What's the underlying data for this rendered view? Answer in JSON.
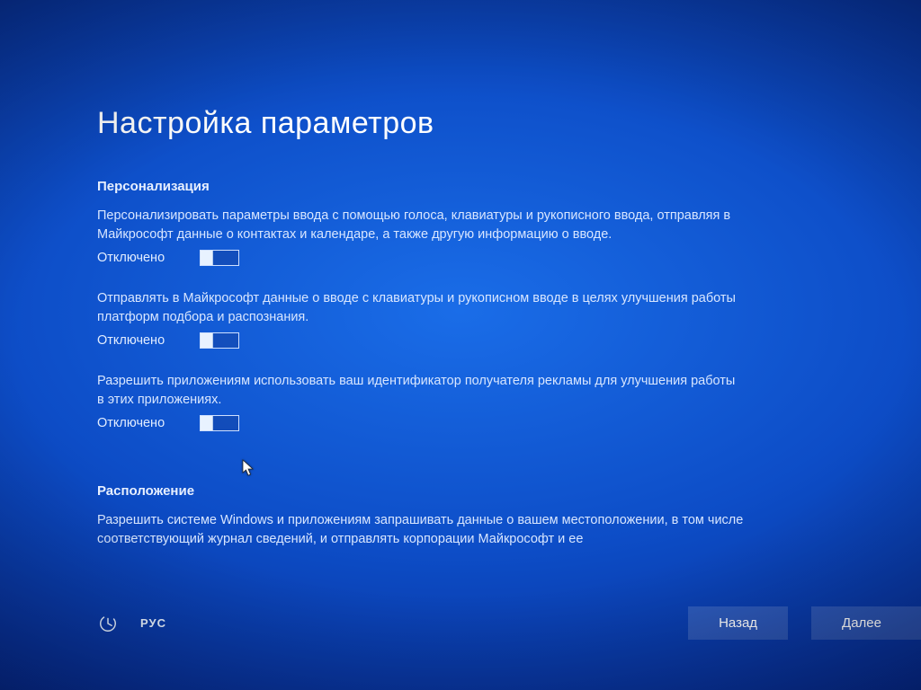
{
  "page": {
    "title": "Настройка параметров"
  },
  "sections": {
    "personalization": {
      "header": "Персонализация",
      "items": [
        {
          "desc": "Персонализировать параметры ввода с помощью голоса, клавиатуры и рукописного ввода, отправляя в Майкрософт данные о контактах и календаре, а также другую информацию о вводе.",
          "state": "Отключено"
        },
        {
          "desc": "Отправлять в Майкрософт данные о вводе с клавиатуры и рукописном вводе в целях улучшения работы платформ подбора и распознания.",
          "state": "Отключено"
        },
        {
          "desc": "Разрешить приложениям использовать ваш идентификатор получателя рекламы для улучшения работы в этих приложениях.",
          "state": "Отключено"
        }
      ]
    },
    "location": {
      "header": "Расположение",
      "items": [
        {
          "desc": "Разрешить системе Windows и приложениям запрашивать данные о вашем местоположении, в том числе соответствующий журнал сведений, и отправлять корпорации Майкрософт и ее"
        }
      ]
    }
  },
  "footer": {
    "language": "РУС",
    "back": "Назад",
    "next": "Далее"
  }
}
